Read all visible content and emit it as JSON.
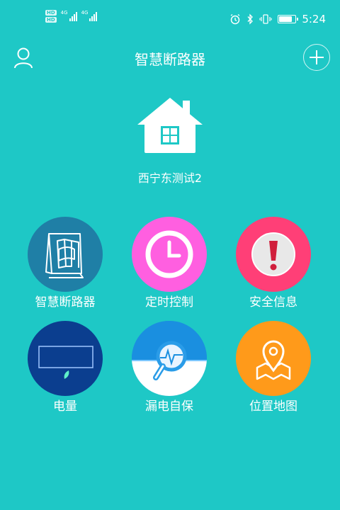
{
  "status_bar": {
    "hd_tags": [
      "HD",
      "HD"
    ],
    "signal_labels": [
      "4G",
      "4G"
    ],
    "time": "5:24",
    "battery_level": 0.95
  },
  "header": {
    "title": "智慧断路器",
    "left_icon": "user-icon",
    "right_icon": "plus-icon"
  },
  "device": {
    "icon": "house-icon",
    "name": "西宁东测试2"
  },
  "menu": [
    {
      "label": "智慧断路器",
      "icon": "breaker-icon",
      "color": "#1f7fa6"
    },
    {
      "label": "定时控制",
      "icon": "clock-icon",
      "color": "#ff5fe0"
    },
    {
      "label": "安全信息",
      "icon": "alert-icon",
      "color": "#ff3f77"
    },
    {
      "label": "电量",
      "icon": "meter-icon",
      "color": "#0b3e8f"
    },
    {
      "label": "漏电自保",
      "icon": "magnifier-icon",
      "color": "#1a8fe0"
    },
    {
      "label": "位置地图",
      "icon": "map-pin-icon",
      "color": "#ff9a1a"
    }
  ]
}
